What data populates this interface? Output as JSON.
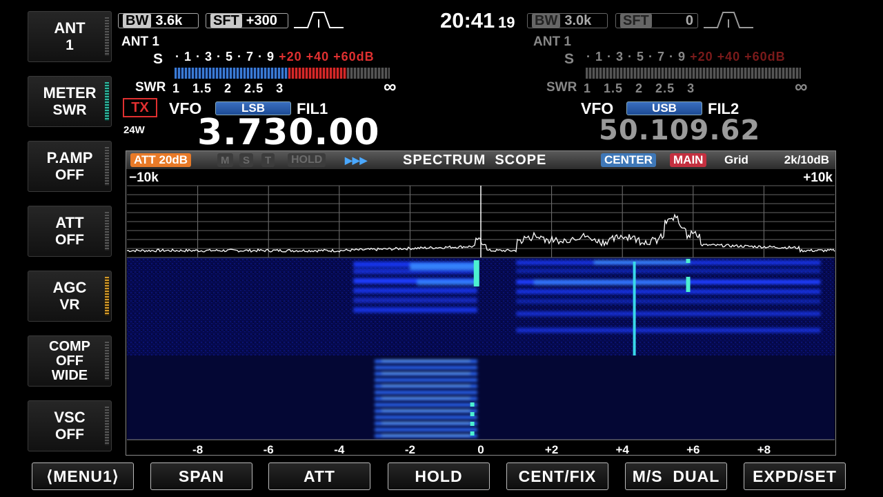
{
  "left_keys": [
    {
      "id": "ant",
      "line1": "ANT",
      "line2": "1",
      "bar": "none"
    },
    {
      "id": "meter",
      "line1": "METER",
      "line2": "SWR",
      "bar": "teal"
    },
    {
      "id": "pamp",
      "line1": "P.AMP",
      "line2": "OFF",
      "bar": "none"
    },
    {
      "id": "att",
      "line1": "ATT",
      "line2": "OFF",
      "bar": "none"
    },
    {
      "id": "agc",
      "line1": "AGC",
      "line2": "VR",
      "bar": "amber"
    },
    {
      "id": "comp",
      "line1": "COMP",
      "line2": "OFF",
      "line3": "WIDE",
      "bar": "none"
    },
    {
      "id": "vsc",
      "line1": "VSC",
      "line2": "OFF",
      "bar": "none"
    }
  ],
  "main": {
    "bw_tag": "BW",
    "bw_value": "3.6k",
    "sft_tag": "SFT",
    "sft_value": "+300",
    "ant_label": "ANT 1",
    "s_label": "S",
    "s_scale": "· 1 · 3 · 5 · 7 · 9",
    "s_scale_over": "+20 +40 +60dB",
    "swr_label": "SWR",
    "swr_scale": "1   1.5   2   2.5   3",
    "swr_inf": "∞",
    "tx_label": "TX",
    "power": "24W",
    "vfo_label": "VFO",
    "mode": "LSB",
    "filter": "FIL1",
    "frequency": "3.730.00",
    "s_meter_fraction": 0.53,
    "po_red_fraction": 0.27
  },
  "clock": {
    "time": "20:41",
    "seconds": "19"
  },
  "sub": {
    "bw_tag": "BW",
    "bw_value": "3.0k",
    "sft_tag": "SFT",
    "sft_value": "0",
    "ant_label": "ANT 1",
    "s_label": "S",
    "s_scale": "· 1 · 3 · 5 · 7 · 9",
    "s_scale_over": "+20 +40 +60dB",
    "swr_label": "SWR",
    "swr_scale": "1   1.5   2   2.5   3",
    "swr_inf": "∞",
    "vfo_label": "VFO",
    "mode": "USB",
    "filter": "FIL2",
    "frequency": "50.109.62"
  },
  "scope": {
    "att_badge": "ATT 20dB",
    "m_badge": "M",
    "s_badge": "S",
    "t_badge": "T",
    "hold_badge": "HOLD",
    "speed_glyph": "▶▶▶",
    "title": "SPECTRUM  SCOPE",
    "center_badge": "CENTER",
    "main_badge": "MAIN",
    "grid_label": "Grid",
    "span_ref": "2k/10dB",
    "left_edge": "−10k",
    "right_edge": "+10k",
    "axis_ticks": [
      "-8",
      "-6",
      "-4",
      "-2",
      "0",
      "+2",
      "+4",
      "+6",
      "+8"
    ],
    "colors": {
      "waterfall_bg": "#060a55",
      "signal": "#1a3cff",
      "hot": "#4cf0d0",
      "trace": "#ffffff"
    }
  },
  "bottom_keys": [
    "⟨MENU1⟩",
    "SPAN",
    "ATT",
    "HOLD",
    "CENT/FIX",
    "M/S  DUAL",
    "EXPD/SET"
  ]
}
